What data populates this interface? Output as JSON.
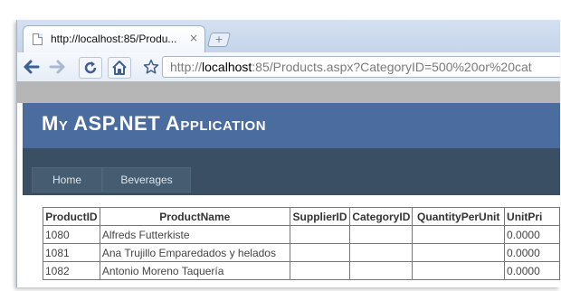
{
  "browser": {
    "tab_title": "http://localhost:85/Produ...",
    "tab_close": "×",
    "new_tab": "+",
    "nav": {
      "back_icon": "arrow-left",
      "forward_icon": "arrow-right",
      "reload_icon": "reload",
      "home_icon": "home",
      "star_icon": "star"
    },
    "url_prefix": "http://",
    "url_host": "localhost",
    "url_rest": ":85/Products.aspx?CategoryID=500%20or%20cat"
  },
  "site": {
    "title": "My ASP.NET Application",
    "menu": [
      "Home",
      "Beverages"
    ],
    "header_color": "#4b6c9e",
    "menu_color": "#3a4f63"
  },
  "grid": {
    "columns": [
      "ProductID",
      "ProductName",
      "SupplierID",
      "CategoryID",
      "QuantityPerUnit",
      "UnitPri"
    ],
    "rows": [
      [
        "1080",
        "Alfreds Futterkiste",
        "",
        "",
        "",
        "0.0000"
      ],
      [
        "1081",
        "Ana Trujillo Emparedados y helados",
        "",
        "",
        "",
        "0.0000"
      ],
      [
        "1082",
        "Antonio Moreno Taquería",
        "",
        "",
        "",
        "0.0000"
      ]
    ]
  }
}
